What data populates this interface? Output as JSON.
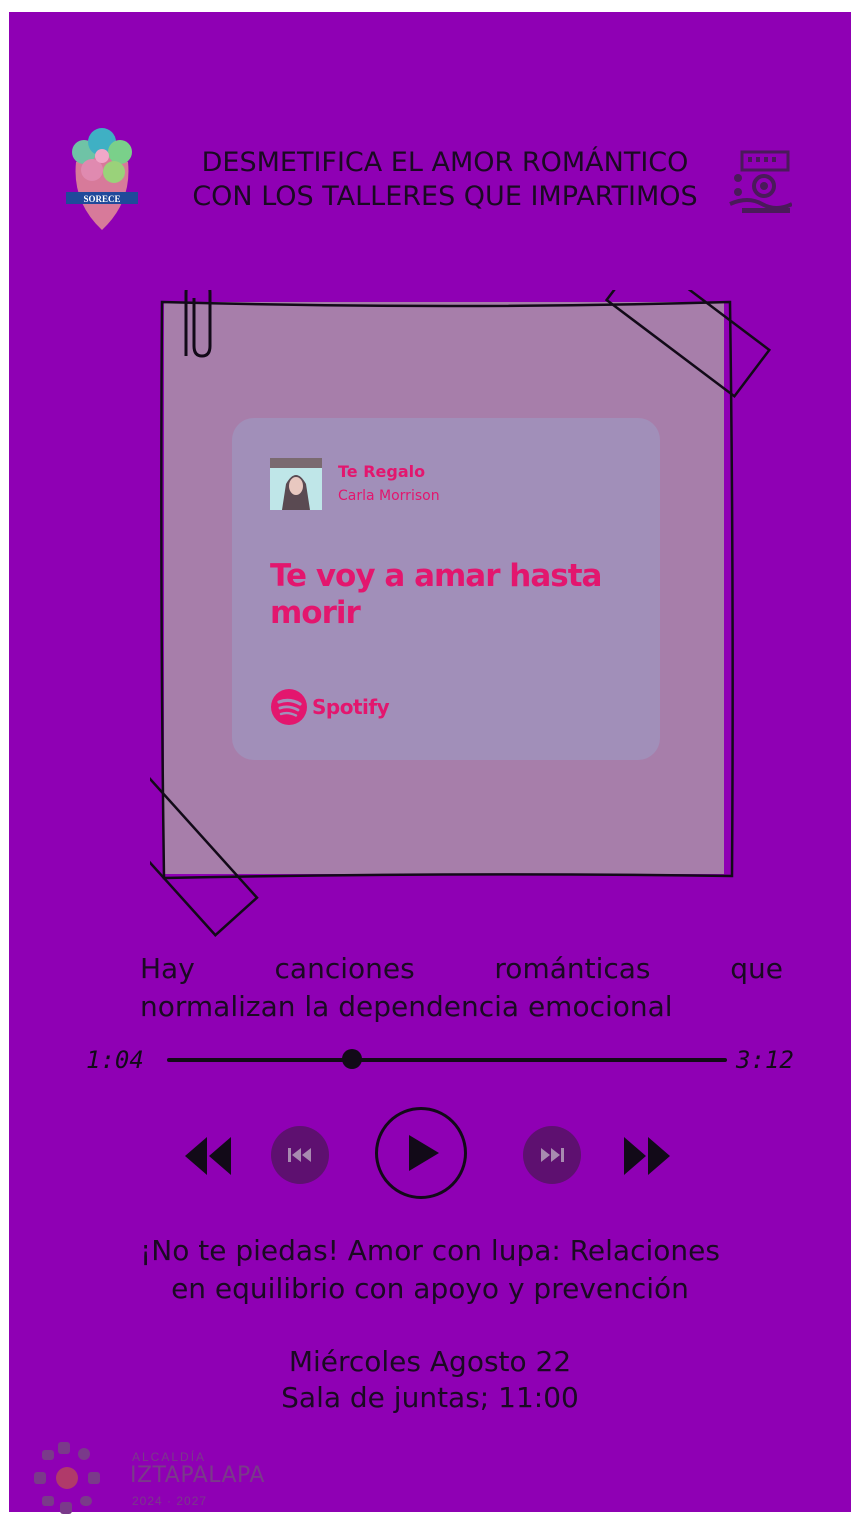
{
  "header": {
    "title_line1": "DESMETIFICA EL AMOR ROMÁNTICO",
    "title_line2": "CON LOS TALLERES QUE IMPARTIMOS",
    "left_logo_text": "SORECE"
  },
  "song_card": {
    "title": "Te Regalo",
    "artist": "Carla Morrison",
    "lyric": "Te voy a amar hasta morir",
    "brand": "Spotify"
  },
  "description": {
    "line1": "Hay canciones románticas que",
    "line2": "normalizan la dependencia emocional"
  },
  "player": {
    "elapsed": "1:04",
    "duration": "3:12",
    "progress": 0.33
  },
  "event": {
    "title_line1": "¡No te piedas! Amor con lupa: Relaciones",
    "title_line2": "en equilibrio con apoyo y prevención",
    "date": "Miércoles Agosto 22",
    "place_time": "Sala de juntas; 11:00"
  },
  "footer": {
    "org_small": "ALCALDÍA",
    "org_name": "IZTAPALAPA",
    "years": "2024 · 2027"
  },
  "colors": {
    "background": "#8f00b4",
    "note": "#a77eaa",
    "card": "#a18fb9",
    "accent": "#e3166e",
    "button": "#5e1070",
    "ink": "#120a18"
  }
}
